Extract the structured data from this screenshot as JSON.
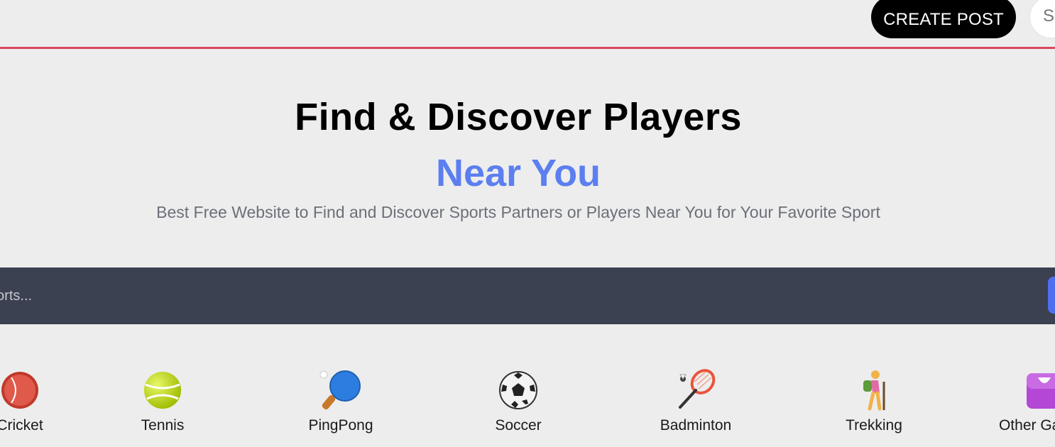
{
  "header": {
    "create_post_label": "CREATE POST",
    "signin_label": "S"
  },
  "hero": {
    "title": "Find & Discover Players",
    "subtitle": "Near You",
    "description": "Best Free Website to Find and Discover Sports Partners or Players Near You for Your Favorite Sport"
  },
  "search": {
    "placeholder": "Search sports..."
  },
  "sports": [
    {
      "label": "Cricket",
      "icon": "cricket-icon"
    },
    {
      "label": "Tennis",
      "icon": "tennis-ball-icon"
    },
    {
      "label": "PingPong",
      "icon": "ping-pong-icon"
    },
    {
      "label": "Soccer",
      "icon": "soccer-ball-icon"
    },
    {
      "label": "Badminton",
      "icon": "badminton-icon"
    },
    {
      "label": "Trekking",
      "icon": "hiker-icon"
    },
    {
      "label": "Other Games",
      "icon": "game-box-icon"
    }
  ],
  "colors": {
    "accent_blue": "#5b7ff0",
    "header_border": "#d9485f",
    "search_band": "#3b4150",
    "button_black": "#000000"
  }
}
